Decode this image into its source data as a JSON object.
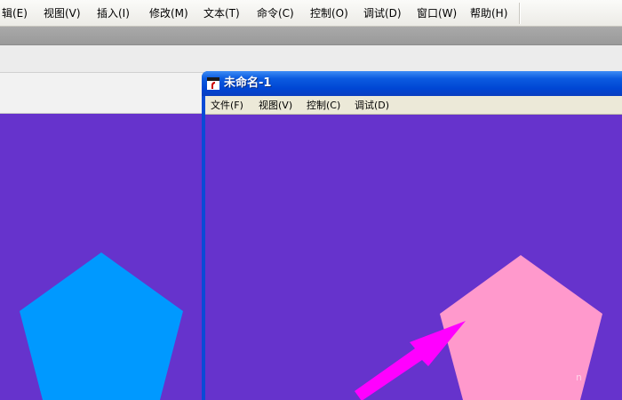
{
  "main_menu": [
    {
      "name": "menu-edit",
      "label": "辑(E)"
    },
    {
      "name": "menu-view",
      "label": "视图(V)"
    },
    {
      "name": "menu-insert",
      "label": "插入(I)"
    },
    {
      "name": "menu-modify",
      "label": "修改(M)"
    },
    {
      "name": "menu-text",
      "label": "文本(T)"
    },
    {
      "name": "menu-commands",
      "label": "命令(C)"
    },
    {
      "name": "menu-control",
      "label": "控制(O)"
    },
    {
      "name": "menu-debug",
      "label": "调试(D)"
    },
    {
      "name": "menu-window",
      "label": "窗口(W)"
    },
    {
      "name": "menu-help",
      "label": "帮助(H)"
    }
  ],
  "player_window": {
    "title": "未命名-1",
    "menu": [
      {
        "name": "player-menu-file",
        "label": "文件(F)"
      },
      {
        "name": "player-menu-view",
        "label": "视图(V)"
      },
      {
        "name": "player-menu-control",
        "label": "控制(C)"
      },
      {
        "name": "player-menu-debug",
        "label": "调试(D)"
      }
    ]
  },
  "colors": {
    "stage_background": "#6633cc",
    "pentagon_left": "#0099ff",
    "pentagon_right": "#ff99cc",
    "arrow": "#ff00ff"
  },
  "watermark": "n"
}
